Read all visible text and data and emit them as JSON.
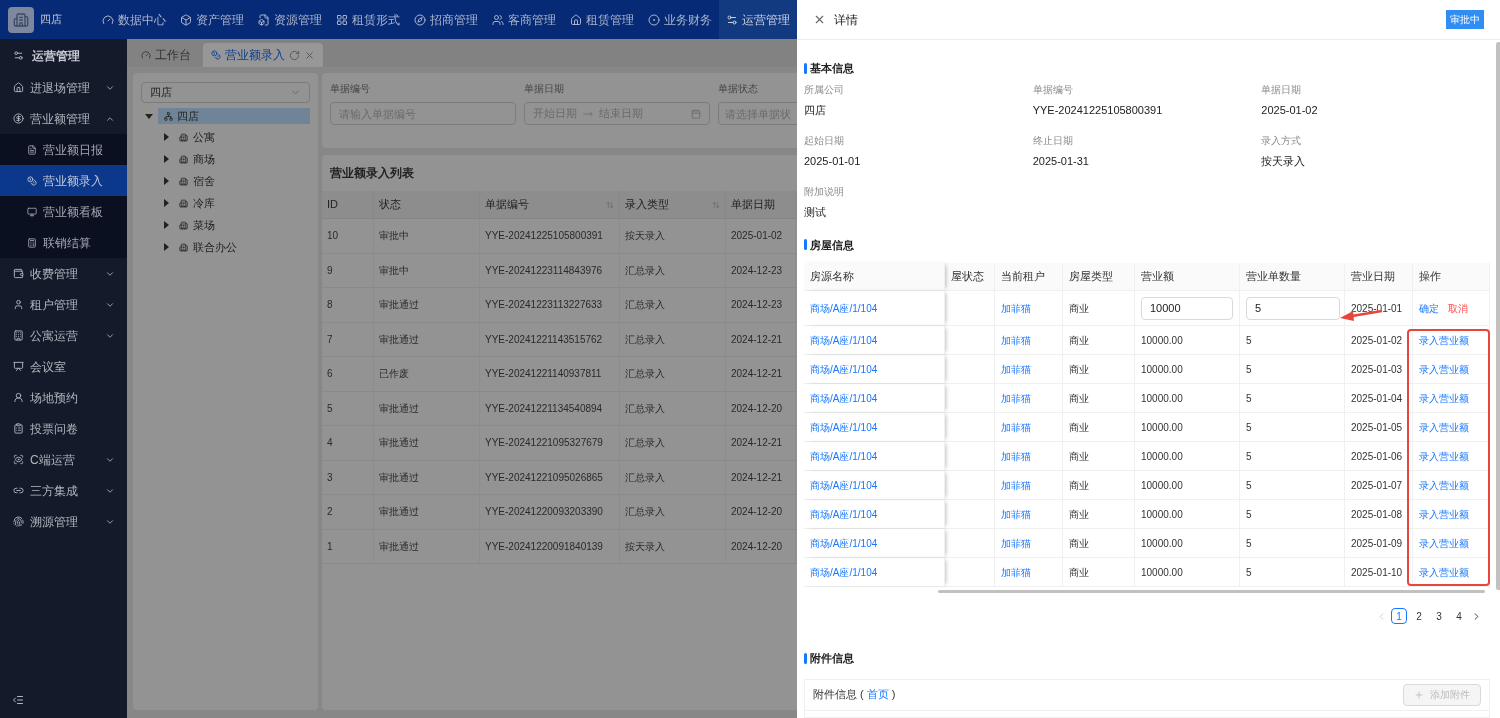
{
  "top_nav": {
    "brand": "四店",
    "items": [
      {
        "label": "数据中心",
        "selected": false
      },
      {
        "label": "资产管理",
        "selected": false
      },
      {
        "label": "资源管理",
        "selected": false
      },
      {
        "label": "租赁形式",
        "selected": false
      },
      {
        "label": "招商管理",
        "selected": false
      },
      {
        "label": "客商管理",
        "selected": false
      },
      {
        "label": "租赁管理",
        "selected": false
      },
      {
        "label": "业务财务",
        "selected": false
      },
      {
        "label": "运营管理",
        "selected": true
      }
    ]
  },
  "sidebar": {
    "title": "运营管理",
    "items": [
      {
        "label": "进退场管理",
        "kind": "group",
        "expanded": false
      },
      {
        "label": "营业额管理",
        "kind": "group",
        "expanded": true,
        "children": [
          {
            "label": "营业额日报",
            "selected": false
          },
          {
            "label": "营业额录入",
            "selected": true
          },
          {
            "label": "营业额看板",
            "selected": false
          },
          {
            "label": "联销结算",
            "selected": false
          }
        ]
      },
      {
        "label": "收费管理",
        "kind": "group",
        "expanded": false
      },
      {
        "label": "租户管理",
        "kind": "group",
        "expanded": false
      },
      {
        "label": "公寓运营",
        "kind": "group",
        "expanded": false
      },
      {
        "label": "会议室",
        "kind": "link"
      },
      {
        "label": "场地预约",
        "kind": "link"
      },
      {
        "label": "投票问卷",
        "kind": "link"
      },
      {
        "label": "C端运营",
        "kind": "group",
        "expanded": false
      },
      {
        "label": "三方集成",
        "kind": "group",
        "expanded": false
      },
      {
        "label": "溯源管理",
        "kind": "group",
        "expanded": false
      }
    ]
  },
  "tabs": [
    {
      "label": "工作台",
      "selected": false
    },
    {
      "label": "营业额录入",
      "selected": true
    }
  ],
  "tree": {
    "select_value": "四店",
    "root": {
      "label": "四店",
      "selected": true,
      "expanded": true,
      "children": [
        {
          "label": "公寓",
          "expanded": false
        },
        {
          "label": "商场",
          "expanded": false
        },
        {
          "label": "宿舍",
          "expanded": false
        },
        {
          "label": "冷库",
          "expanded": false
        },
        {
          "label": "菜场",
          "expanded": false
        },
        {
          "label": "联合办公",
          "expanded": false
        }
      ]
    }
  },
  "filters": {
    "number": {
      "label": "单据编号",
      "placeholder": "请输入单据编号"
    },
    "date": {
      "label": "单据日期",
      "start_placeholder": "开始日期",
      "end_placeholder": "结束日期"
    },
    "status": {
      "label": "单据状态",
      "placeholder": "请选择单据状"
    }
  },
  "list": {
    "title": "营业额录入列表",
    "columns": [
      {
        "label": "ID",
        "sortable": false
      },
      {
        "label": "状态",
        "sortable": false
      },
      {
        "label": "单据编号",
        "sortable": true
      },
      {
        "label": "录入类型",
        "sortable": true
      },
      {
        "label": "单据日期",
        "sortable": false
      }
    ],
    "rows": [
      [
        "10",
        "审批中",
        "YYE-20241225105800391",
        "按天录入",
        "2025-01-02"
      ],
      [
        "9",
        "审批中",
        "YYE-20241223114843976",
        "汇总录入",
        "2024-12-23"
      ],
      [
        "8",
        "审批通过",
        "YYE-20241223113227633",
        "汇总录入",
        "2024-12-23"
      ],
      [
        "7",
        "审批通过",
        "YYE-20241221143515762",
        "汇总录入",
        "2024-12-21"
      ],
      [
        "6",
        "已作废",
        "YYE-20241221140937811",
        "汇总录入",
        "2024-12-21"
      ],
      [
        "5",
        "审批通过",
        "YYE-20241221134540894",
        "汇总录入",
        "2024-12-20"
      ],
      [
        "4",
        "审批通过",
        "YYE-20241221095327679",
        "汇总录入",
        "2024-12-21"
      ],
      [
        "3",
        "审批通过",
        "YYE-20241221095026865",
        "汇总录入",
        "2024-12-21"
      ],
      [
        "2",
        "审批通过",
        "YYE-20241220093203390",
        "汇总录入",
        "2024-12-20"
      ],
      [
        "1",
        "审批通过",
        "YYE-20241220091840139",
        "按天录入",
        "2024-12-20"
      ]
    ]
  },
  "drawer": {
    "title": "详情",
    "status_badge": "审批中",
    "basic": {
      "title": "基本信息",
      "fields": [
        {
          "label": "所属公司",
          "value": "四店"
        },
        {
          "label": "单据编号",
          "value": "YYE-20241225105800391"
        },
        {
          "label": "单据日期",
          "value": "2025-01-02"
        },
        {
          "label": "起始日期",
          "value": "2025-01-01"
        },
        {
          "label": "终止日期",
          "value": "2025-01-31"
        },
        {
          "label": "录入方式",
          "value": "按天录入"
        },
        {
          "label": "附加说明",
          "value": "测试"
        }
      ]
    },
    "house": {
      "title": "房屋信息",
      "columns": [
        "房源名称",
        "屋状态",
        "当前租户",
        "房屋类型",
        "营业额",
        "营业单数量",
        "营业日期",
        "操作"
      ],
      "rows": [
        {
          "kind": "edit",
          "name": "商场/A座/1/104",
          "tenant": "加菲猫",
          "type": "商业",
          "amount": "10000",
          "count": "5",
          "date": "2025-01-01",
          "actions": [
            {
              "label": "确定",
              "kind": "primary"
            },
            {
              "label": "取消",
              "kind": "danger"
            }
          ]
        },
        {
          "kind": "view",
          "name": "商场/A座/1/104",
          "tenant": "加菲猫",
          "type": "商业",
          "amount": "10000.00",
          "count": "5",
          "date": "2025-01-02",
          "actions": [
            {
              "label": "录入营业额",
              "kind": "primary"
            }
          ]
        },
        {
          "kind": "view",
          "name": "商场/A座/1/104",
          "tenant": "加菲猫",
          "type": "商业",
          "amount": "10000.00",
          "count": "5",
          "date": "2025-01-03",
          "actions": [
            {
              "label": "录入营业额",
              "kind": "primary"
            }
          ]
        },
        {
          "kind": "view",
          "name": "商场/A座/1/104",
          "tenant": "加菲猫",
          "type": "商业",
          "amount": "10000.00",
          "count": "5",
          "date": "2025-01-04",
          "actions": [
            {
              "label": "录入营业额",
              "kind": "primary"
            }
          ]
        },
        {
          "kind": "view",
          "name": "商场/A座/1/104",
          "tenant": "加菲猫",
          "type": "商业",
          "amount": "10000.00",
          "count": "5",
          "date": "2025-01-05",
          "actions": [
            {
              "label": "录入营业额",
              "kind": "primary"
            }
          ]
        },
        {
          "kind": "view",
          "name": "商场/A座/1/104",
          "tenant": "加菲猫",
          "type": "商业",
          "amount": "10000.00",
          "count": "5",
          "date": "2025-01-06",
          "actions": [
            {
              "label": "录入营业额",
              "kind": "primary"
            }
          ]
        },
        {
          "kind": "view",
          "name": "商场/A座/1/104",
          "tenant": "加菲猫",
          "type": "商业",
          "amount": "10000.00",
          "count": "5",
          "date": "2025-01-07",
          "actions": [
            {
              "label": "录入营业额",
              "kind": "primary"
            }
          ]
        },
        {
          "kind": "view",
          "name": "商场/A座/1/104",
          "tenant": "加菲猫",
          "type": "商业",
          "amount": "10000.00",
          "count": "5",
          "date": "2025-01-08",
          "actions": [
            {
              "label": "录入营业额",
              "kind": "primary"
            }
          ]
        },
        {
          "kind": "view",
          "name": "商场/A座/1/104",
          "tenant": "加菲猫",
          "type": "商业",
          "amount": "10000.00",
          "count": "5",
          "date": "2025-01-09",
          "actions": [
            {
              "label": "录入营业额",
              "kind": "primary"
            }
          ]
        },
        {
          "kind": "view",
          "name": "商场/A座/1/104",
          "tenant": "加菲猫",
          "type": "商业",
          "amount": "10000.00",
          "count": "5",
          "date": "2025-01-10",
          "actions": [
            {
              "label": "录入营业额",
              "kind": "primary"
            }
          ]
        }
      ],
      "pagination": {
        "prev_disabled": true,
        "next_disabled": false,
        "pages": [
          {
            "label": "1",
            "selected": true
          },
          {
            "label": "2",
            "selected": false
          },
          {
            "label": "3",
            "selected": false
          },
          {
            "label": "4",
            "selected": false
          }
        ]
      }
    },
    "attachments": {
      "title": "附件信息",
      "box_label": "附件信息 (",
      "link": "首页",
      "box_suffix": ")",
      "button": {
        "label": "添加附件",
        "disabled": true
      }
    }
  }
}
